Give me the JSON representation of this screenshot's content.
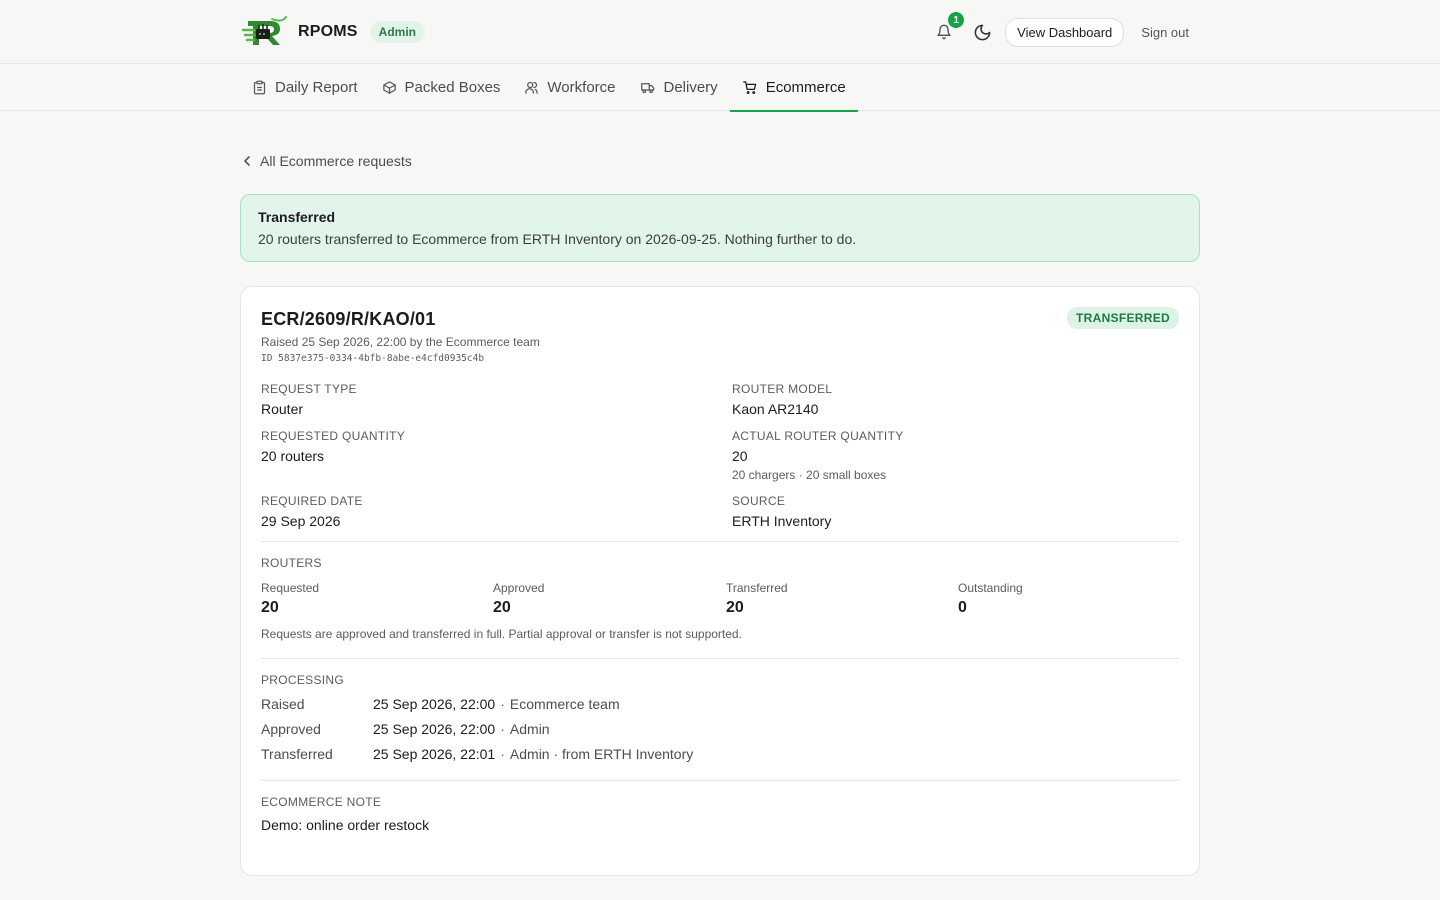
{
  "app": {
    "name": "RPOMS",
    "role": "Admin"
  },
  "header": {
    "notification_count": "1",
    "view_dashboard_label": "View Dashboard",
    "sign_out_label": "Sign out"
  },
  "tabs": [
    {
      "label": "Daily Report",
      "icon": "clipboard-icon"
    },
    {
      "label": "Packed Boxes",
      "icon": "box-icon"
    },
    {
      "label": "Workforce",
      "icon": "user-icon"
    },
    {
      "label": "Delivery",
      "icon": "truck-icon"
    },
    {
      "label": "Ecommerce",
      "icon": "cart-icon",
      "active": true
    }
  ],
  "back_link": "All Ecommerce requests",
  "alert": {
    "title": "Transferred",
    "text": "20 routers transferred to Ecommerce from ERTH Inventory on 2026-09-25. Nothing further to do."
  },
  "request": {
    "code": "ECR/2609/R/KAO/01",
    "status": "TRANSFERRED",
    "raised_line": "Raised 25 Sep 2026, 22:00 by the Ecommerce team",
    "uuid_line": "ID 5837e375-0334-4bfb-8abe-e4cfd0935c4b",
    "fields": {
      "request_type": {
        "label": "REQUEST TYPE",
        "value": "Router"
      },
      "router_model": {
        "label": "ROUTER MODEL",
        "value": "Kaon AR2140"
      },
      "requested_quantity": {
        "label": "REQUESTED QUANTITY",
        "value": "20 routers"
      },
      "actual_quantity": {
        "label": "ACTUAL ROUTER QUANTITY",
        "value": "20",
        "sub": "20 chargers · 20 small boxes"
      },
      "required_date": {
        "label": "REQUIRED DATE",
        "value": "29 Sep 2026"
      },
      "source": {
        "label": "SOURCE",
        "value": "ERTH Inventory"
      }
    }
  },
  "routers": {
    "label": "ROUTERS",
    "stats": [
      {
        "label": "Requested",
        "value": "20"
      },
      {
        "label": "Approved",
        "value": "20"
      },
      {
        "label": "Transferred",
        "value": "20"
      },
      {
        "label": "Outstanding",
        "value": "0"
      }
    ],
    "note": "Requests are approved and transferred in full. Partial approval or transfer is not supported."
  },
  "processing": {
    "label": "PROCESSING",
    "rows": [
      {
        "name": "Raised",
        "time": "25 Sep 2026, 22:00",
        "who": "Ecommerce team"
      },
      {
        "name": "Approved",
        "time": "25 Sep 2026, 22:00",
        "who": "Admin"
      },
      {
        "name": "Transferred",
        "time": "25 Sep 2026, 22:01",
        "who": "Admin · from ERTH Inventory"
      }
    ]
  },
  "ecommerce_note": {
    "label": "ECOMMERCE NOTE",
    "value": "Demo: online order restock"
  },
  "colors": {
    "accent": "#16a34a",
    "alert_bg": "#e1f5ea",
    "alert_border": "#a8dfc0",
    "badge_bg": "#dcf3e6",
    "badge_text": "#1d7a47"
  }
}
